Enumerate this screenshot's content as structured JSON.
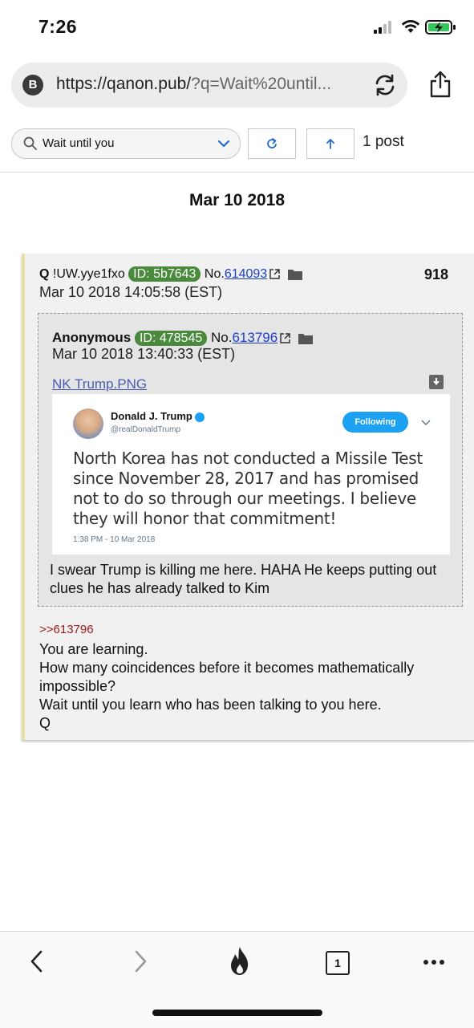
{
  "status_bar": {
    "time": "7:26"
  },
  "browser": {
    "site_badge": "B",
    "url_main": "https://qanon.pub/",
    "url_query": "?q=Wait%20until...",
    "icons": [
      "reload-icon",
      "share-icon"
    ]
  },
  "search": {
    "value": "Wait until you",
    "post_count": "1 post",
    "icons": [
      "search-icon",
      "chevron-down-icon",
      "refresh-icon",
      "arrow-up-icon"
    ]
  },
  "date_heading": "Mar 10 2018",
  "post": {
    "author": "Q",
    "tripcode": "!UW.yye1fxo",
    "id_badge": "ID: 5b7643",
    "no_prefix": "No.",
    "number": "614093",
    "post_index": "918",
    "timestamp": "Mar 10 2018 14:05:58 (EST)",
    "reply_link": ">>613796",
    "body": [
      "You are learning.",
      "How many coincidences before it becomes mathematically impossible?",
      "Wait until you learn who has been talking to you here.",
      "Q"
    ]
  },
  "quoted_post": {
    "author": "Anonymous",
    "id_badge": "ID: 478545",
    "no_prefix": "No.",
    "number": "613796",
    "timestamp": "Mar 10 2018 13:40:33 (EST)",
    "filename": "NK Trump.PNG",
    "body": "I swear Trump is killing me here. HAHA He keeps putting out clues he has already talked to Kim"
  },
  "tweet": {
    "name": "Donald J. Trump",
    "handle": "@realDonaldTrump",
    "follow_label": "Following",
    "text": "North Korea has not conducted a Missile Test since November 28, 2017 and has promised not to do so through our meetings. I believe they will honor that commitment!",
    "time": "1:38 PM - 10 Mar 2018"
  },
  "bottom_nav": {
    "tab_count": "1",
    "icons": [
      "back-icon",
      "forward-icon",
      "flame-icon",
      "tabs-icon",
      "more-icon"
    ]
  },
  "colors": {
    "id_badge": "#4a8a3c",
    "link": "#1a3ec8",
    "reply_link": "#a01818",
    "twitter_blue": "#1da1f2",
    "post_border_accent": "#e7e0a0"
  }
}
